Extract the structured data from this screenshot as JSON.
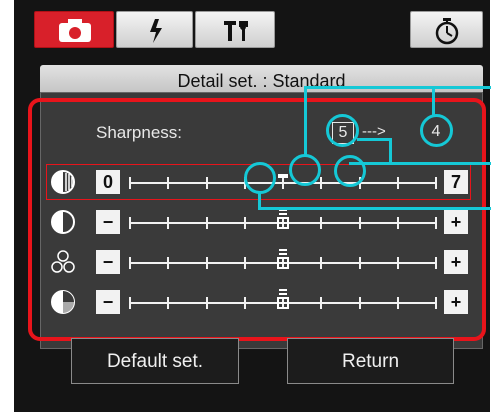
{
  "header": {
    "title": "Detail set. : Standard"
  },
  "sharpness": {
    "label": "Sharpness:",
    "current_value": "5",
    "arrow": "--->",
    "new_value": "4"
  },
  "sliders": [
    {
      "icon": "sharpness-icon",
      "min_label": "0",
      "max_label": "7",
      "value": 4
    },
    {
      "icon": "contrast-icon",
      "min_label": "−",
      "max_label": "+",
      "value": 0
    },
    {
      "icon": "saturation-icon",
      "min_label": "−",
      "max_label": "+",
      "value": 0
    },
    {
      "icon": "color-tone-icon",
      "min_label": "−",
      "max_label": "+",
      "value": 0
    }
  ],
  "tabs": [
    {
      "icon": "camera-icon",
      "active": true
    },
    {
      "icon": "flash-icon",
      "active": false
    },
    {
      "icon": "tools-icon",
      "active": false
    },
    {
      "icon": "timer-icon",
      "active": false
    }
  ],
  "buttons": {
    "default_label": "Default set.",
    "return_label": "Return"
  },
  "colors": {
    "accent_red": "#e8141b",
    "callout_cyan": "#15c8d6"
  }
}
